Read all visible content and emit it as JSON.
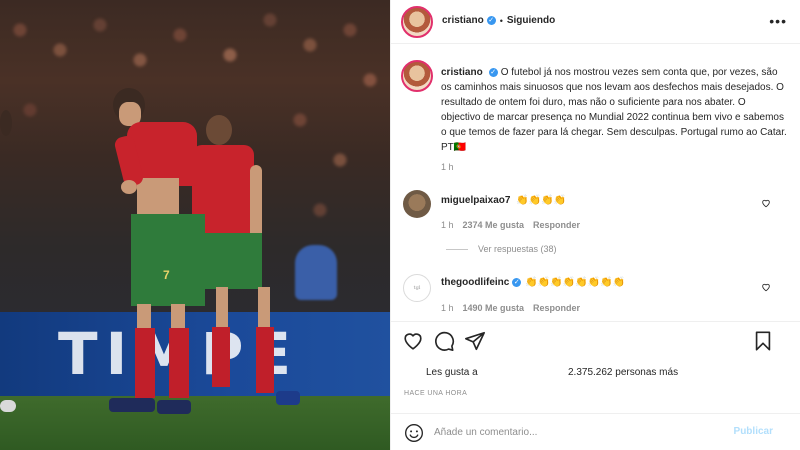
{
  "post": {
    "author": "cristiano",
    "follow_separator": "•",
    "follow_label": "Siguiendo",
    "more_options": "•••",
    "caption": "O futebol já nos mostrou vezes sem conta que, por vezes, são os caminhos mais sinuosos que nos levam aos desfechos mais desejados. O resultado de ontem foi duro, mas não o suficiente para nos abater. O objectivo de marcar presença no Mundial 2022 continua bem vivo e sabemos o que temos de fazer para lá chegar. Sem desculpas. Portugal rumo ao Catar. PT🇵🇹",
    "caption_time": "1 h"
  },
  "photo": {
    "banner_text": "TIMPE",
    "shirt_number": "7"
  },
  "comments": [
    {
      "username": "miguelpaixao7",
      "text": "👏👏👏👏",
      "verified": false,
      "time": "1 h",
      "likes": "2374 Me gusta",
      "reply": "Responder"
    },
    {
      "username": "thegoodlifeinc",
      "text": "👏👏👏👏👏👏👏👏",
      "verified": true,
      "time": "1 h",
      "likes": "1490 Me gusta",
      "reply": "Responder"
    }
  ],
  "replies_toggle": "Ver respuestas (38)",
  "actions": {
    "like_icon": "heart-icon",
    "comment_icon": "comment-icon",
    "share_icon": "share-icon",
    "save_icon": "bookmark-icon"
  },
  "likes": {
    "prefix": "Les gusta a",
    "count": "2.375.262 personas más"
  },
  "time_ago": "HACE UNA HORA",
  "add_comment": {
    "placeholder": "Añade un comentario...",
    "publish_label": "Publicar"
  },
  "colors": {
    "verified": "#3897f0",
    "publish_disabled": "#b2dffc",
    "story_ring": "#e1306c",
    "portugal_red": "#c8232c",
    "portugal_green": "#2f7b3b"
  }
}
